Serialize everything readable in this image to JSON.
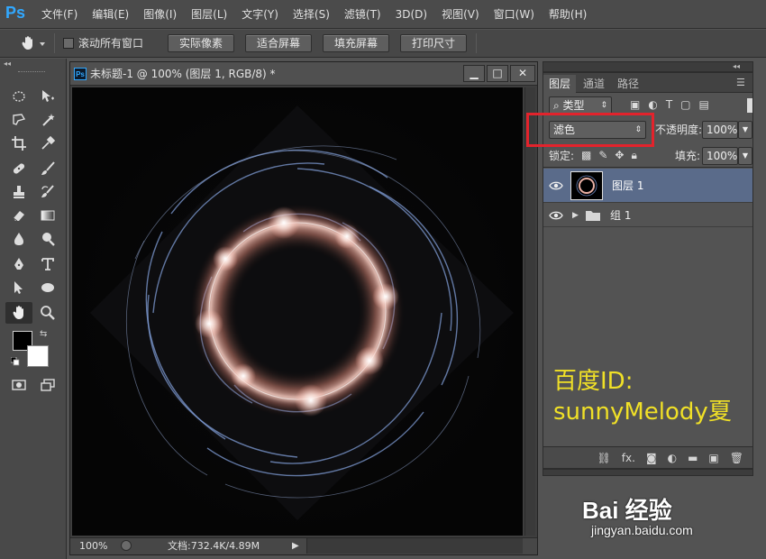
{
  "app": {
    "logo": "Ps"
  },
  "menu": [
    "文件(F)",
    "编辑(E)",
    "图像(I)",
    "图层(L)",
    "文字(Y)",
    "选择(S)",
    "滤镜(T)",
    "3D(D)",
    "视图(V)",
    "窗口(W)",
    "帮助(H)"
  ],
  "options": {
    "scroll_all_label": "滚动所有窗口",
    "actual_pixels": "实际像素",
    "fit_screen": "适合屏幕",
    "fill_screen": "填充屏幕",
    "print_size": "打印尺寸"
  },
  "document": {
    "title": "未标题-1 @ 100% (图层 1, RGB/8) *",
    "zoom": "100%",
    "info": "文档:732.4K/4.89M",
    "minimize": "▁",
    "maximize": "□",
    "close": "✕"
  },
  "layers_panel": {
    "tabs": [
      "图层",
      "通道",
      "路径"
    ],
    "filter_kind": "类型",
    "blend_mode": "滤色",
    "opacity_label": "不透明度:",
    "opacity_value": "100%",
    "lock_label": "锁定:",
    "fill_label": "填充:",
    "fill_value": "100%",
    "layers": [
      {
        "name": "图层 1",
        "selected": true,
        "type": "layer"
      },
      {
        "name": "组 1",
        "selected": false,
        "type": "group"
      }
    ],
    "footer_fx": "fx."
  },
  "overlay": {
    "watermark_line1": "百度ID:",
    "watermark_line2": "sunnyMelody夏",
    "baidu_logo": "Bai 经验",
    "baidu_url": "jingyan.baidu.com"
  },
  "colors": {
    "accent_blue": "#31a8ff",
    "highlight_red": "#e3232c",
    "watermark_yellow": "#f0e027",
    "selected_layer": "#5a6b8a"
  }
}
